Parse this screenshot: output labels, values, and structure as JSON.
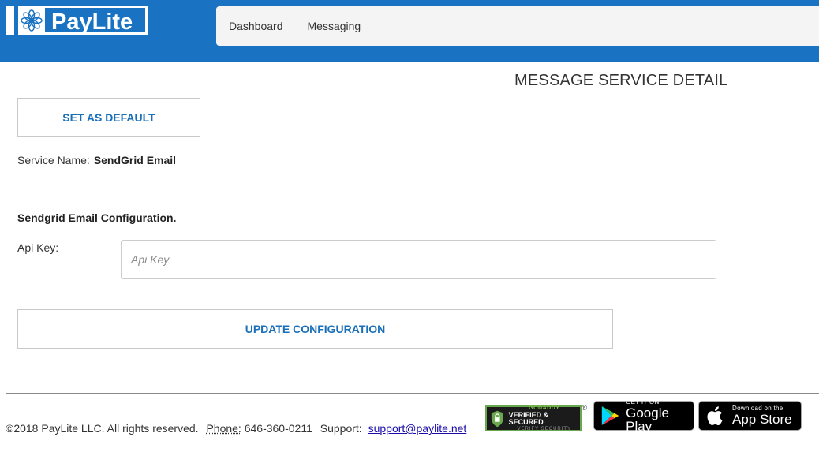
{
  "header": {
    "logo_text": "PayLite",
    "nav": [
      "Dashboard",
      "Messaging"
    ],
    "brand_color": "#1a73c2"
  },
  "main": {
    "page_title": "MESSAGE SERVICE DETAIL",
    "set_default_label": "SET AS DEFAULT",
    "service_name_label": "Service Name:",
    "service_name_value": "SendGrid Email",
    "config_title": "Sendgrid Email Configuration.",
    "api_key_label": "Api Key:",
    "api_key_value": "",
    "api_key_placeholder": "Api Key",
    "update_label": "UPDATE CONFIGURATION"
  },
  "footer": {
    "copyright": "©2018 PayLite LLC. All rights reserved.",
    "phone_label": "Phone:",
    "phone_value": "646-360-0211",
    "support_label": "Support:",
    "support_email": "support@paylite.net",
    "godaddy": {
      "top": "GODADDY",
      "mid": "VERIFIED & SECURED",
      "bot": "VERIFY SECURITY",
      "reg": "®"
    },
    "google_play": {
      "small": "GET IT ON",
      "big": "Google Play"
    },
    "app_store": {
      "small": "Download on the",
      "big": "App Store"
    }
  },
  "icons": {
    "logo": "flower-logo-icon",
    "shield": "shield-check-icon",
    "google": "google-play-icon",
    "apple": "apple-icon"
  }
}
